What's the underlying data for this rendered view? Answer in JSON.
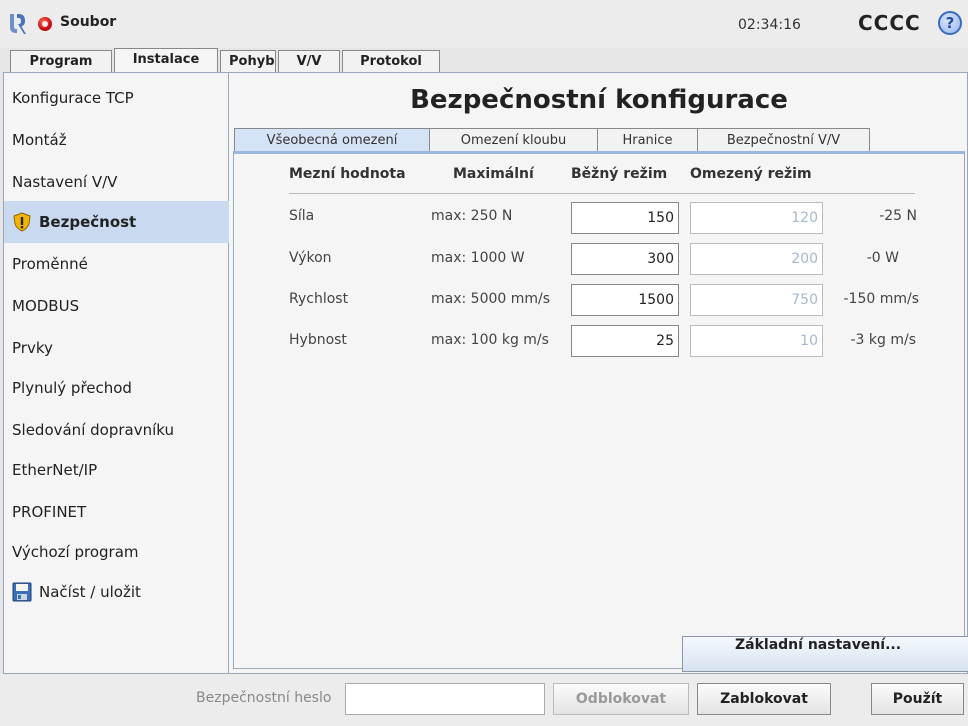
{
  "topbar": {
    "file_menu": "Soubor",
    "clock": "02:34:16",
    "robot_name": "CCCC",
    "help": "?"
  },
  "main_tabs": [
    "Program",
    "Instalace",
    "Pohyb",
    "V/V",
    "Protokol"
  ],
  "main_tabs_active": "Instalace",
  "sidebar": {
    "items": [
      {
        "label": "Konfigurace TCP"
      },
      {
        "label": "Montáž"
      },
      {
        "label": "Nastavení V/V"
      },
      {
        "label": "Bezpečnost",
        "icon": "warning-shield-icon",
        "active": true
      },
      {
        "label": "Proměnné"
      },
      {
        "label": "MODBUS"
      },
      {
        "label": "Prvky"
      },
      {
        "label": "Plynulý přechod"
      },
      {
        "label": "Sledování dopravníku"
      },
      {
        "label": "EtherNet/IP"
      },
      {
        "label": "PROFINET"
      },
      {
        "label": "Výchozí program"
      },
      {
        "label": "Načíst / uložit",
        "icon": "floppy-disk-icon"
      }
    ]
  },
  "content": {
    "title": "Bezpečnostní konfigurace",
    "subtabs": [
      "Všeobecná omezení",
      "Omezení kloubu",
      "Hranice",
      "Bezpečnostní V/V"
    ],
    "subtabs_active": "Všeobecná omezení",
    "table": {
      "headers": {
        "limit": "Mezní hodnota",
        "max": "Maximální",
        "normal": "Běžný režim",
        "reduced": "Omezený režim"
      },
      "rows": [
        {
          "label": "Síla",
          "max": "max: 250 N",
          "normal": "150",
          "reduced": "120",
          "delta": "-25 N"
        },
        {
          "label": "Výkon",
          "max": "max: 1000 W",
          "normal": "300",
          "reduced": "200",
          "delta": "-0 W"
        },
        {
          "label": "Rychlost",
          "max": "max: 5000 mm/s",
          "normal": "1500",
          "reduced": "750",
          "delta": "-150 mm/s"
        },
        {
          "label": "Hybnost",
          "max": "max: 100 kg m/s",
          "normal": "25",
          "reduced": "10",
          "delta": "-3 kg m/s"
        }
      ]
    },
    "default_button": "Základní nastavení..."
  },
  "bottombar": {
    "password_label": "Bezpečnostní heslo",
    "password_value": "",
    "unlock": "Odblokovat",
    "lock": "Zablokovat",
    "apply": "Použít"
  },
  "colors": {
    "active_sidebar": "#c9daf0",
    "active_subtab": "#d4e3f5",
    "panel_border": "#9aa8bd",
    "status_dot": "#d01212",
    "help_icon": "#3a6bc2"
  }
}
